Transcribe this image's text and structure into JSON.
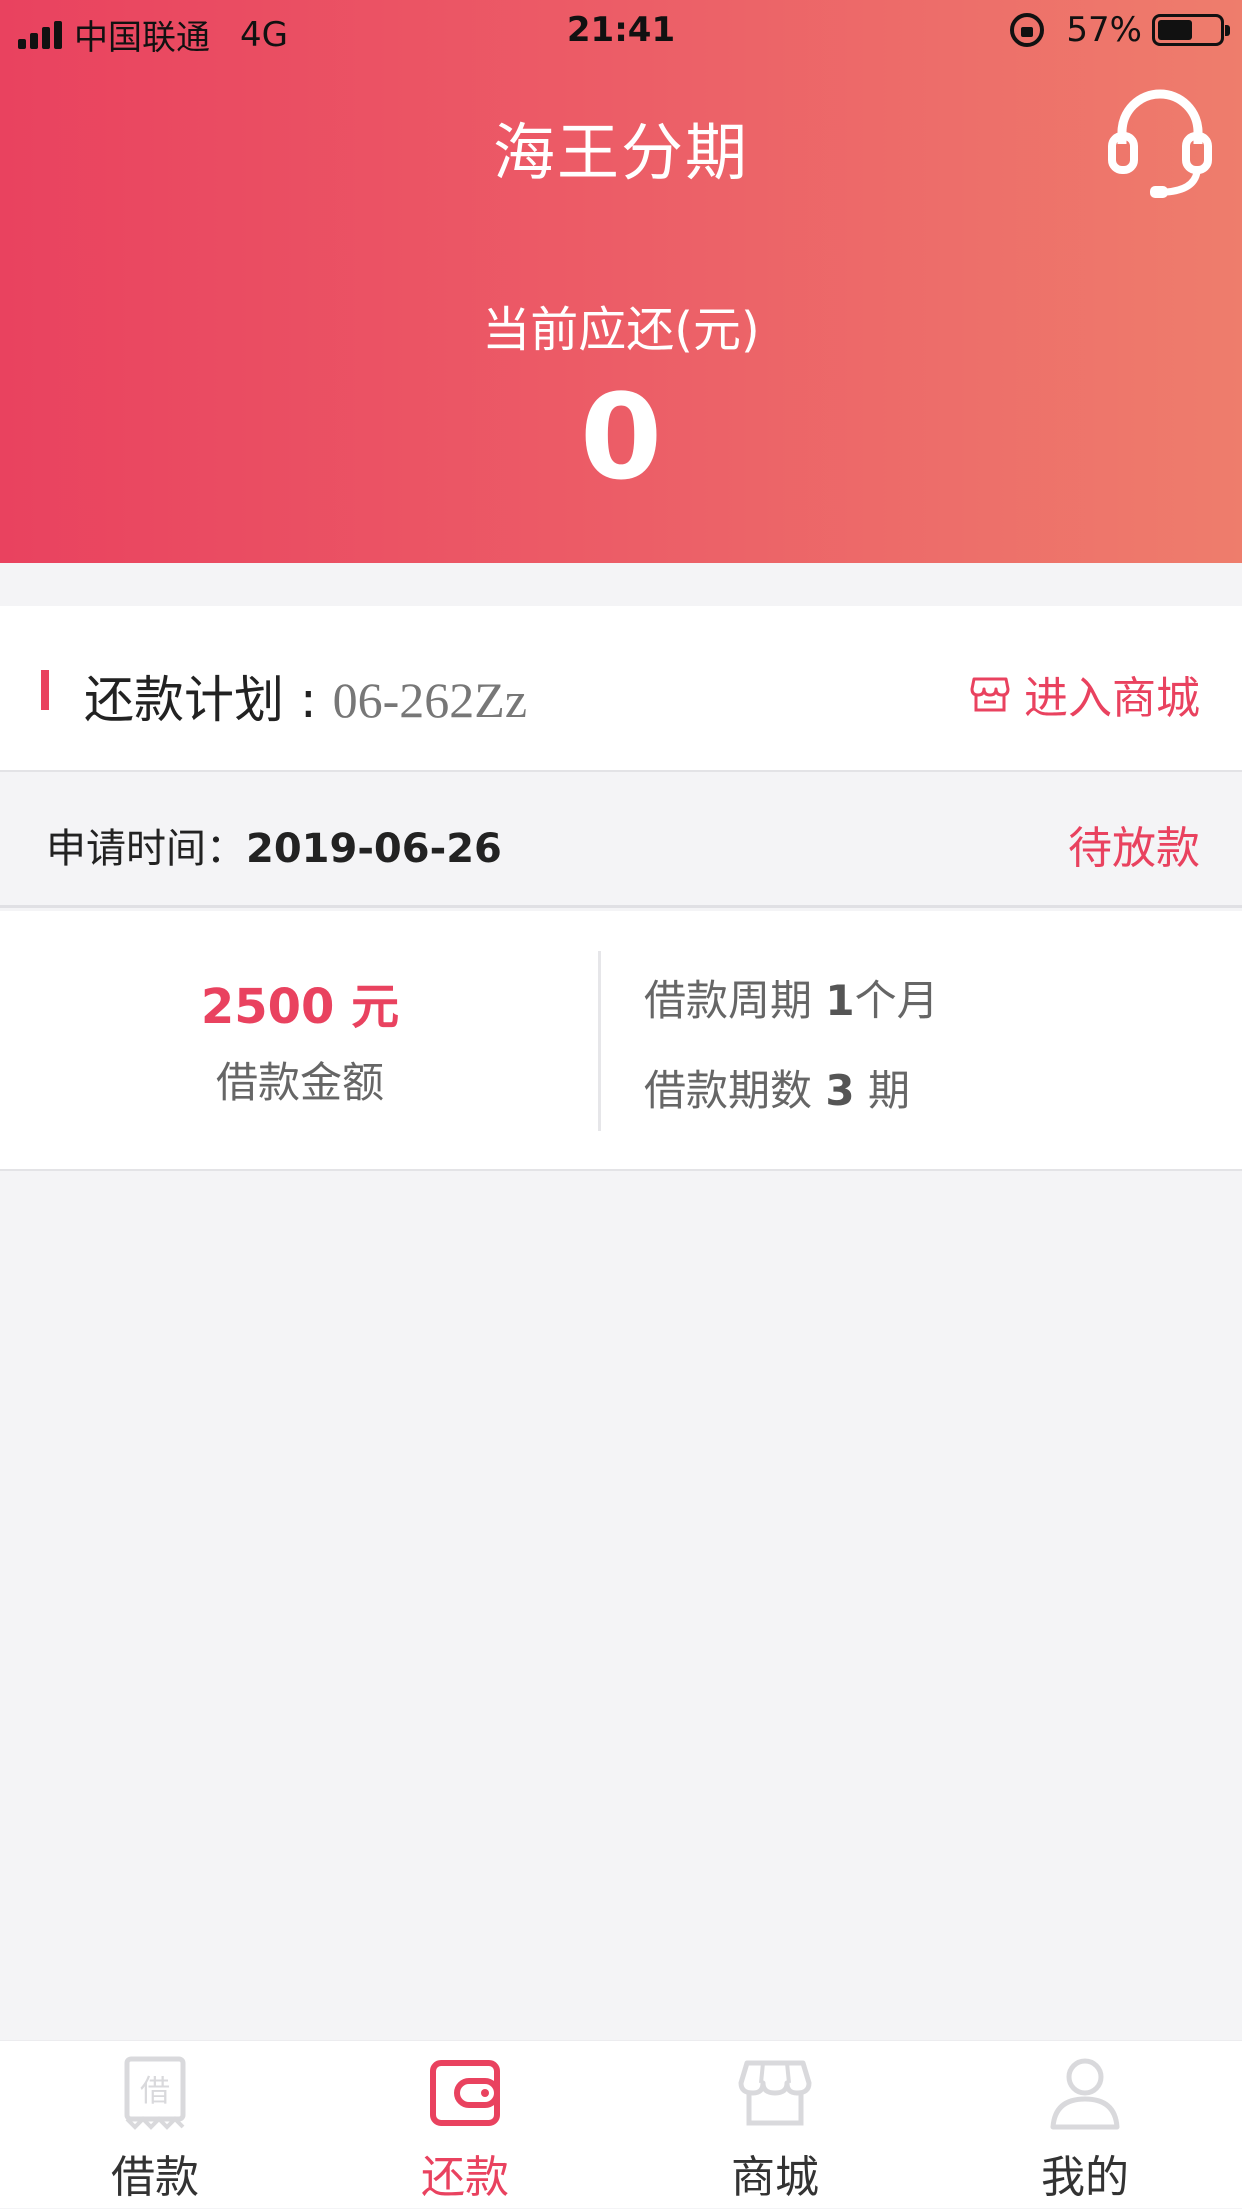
{
  "status_bar": {
    "carrier": "中国联通",
    "network": "4G",
    "time": "21:41",
    "battery": "57%",
    "battery_level": 0.57
  },
  "header": {
    "title": "海王分期",
    "due_label": "当前应还(元)",
    "due_amount": "0",
    "icons": [
      "headset-icon"
    ],
    "gradient": [
      "#e9425f",
      "#ee7d6c"
    ]
  },
  "plan": {
    "label": "还款计划 : ",
    "code": "06-262Zz",
    "enter_mall": "进入商城"
  },
  "application": {
    "label": "申请时间：",
    "date": "2019-06-26",
    "status": "待放款"
  },
  "loan": {
    "amount": "2500 元",
    "amount_label": "借款金额",
    "period_label": "借款周期 ",
    "period_value": "1",
    "period_unit": "个月",
    "count_label": "借款期数 ",
    "count_value": "3",
    "count_unit": " 期"
  },
  "tabs": [
    {
      "label": "借款",
      "icon": "borrow-icon",
      "active": false
    },
    {
      "label": "还款",
      "icon": "wallet-icon",
      "active": true
    },
    {
      "label": "商城",
      "icon": "store-icon",
      "active": false
    },
    {
      "label": "我的",
      "icon": "user-icon",
      "active": false
    }
  ],
  "colors": {
    "accent": "#e9425f",
    "background": "#f4f4f6"
  }
}
